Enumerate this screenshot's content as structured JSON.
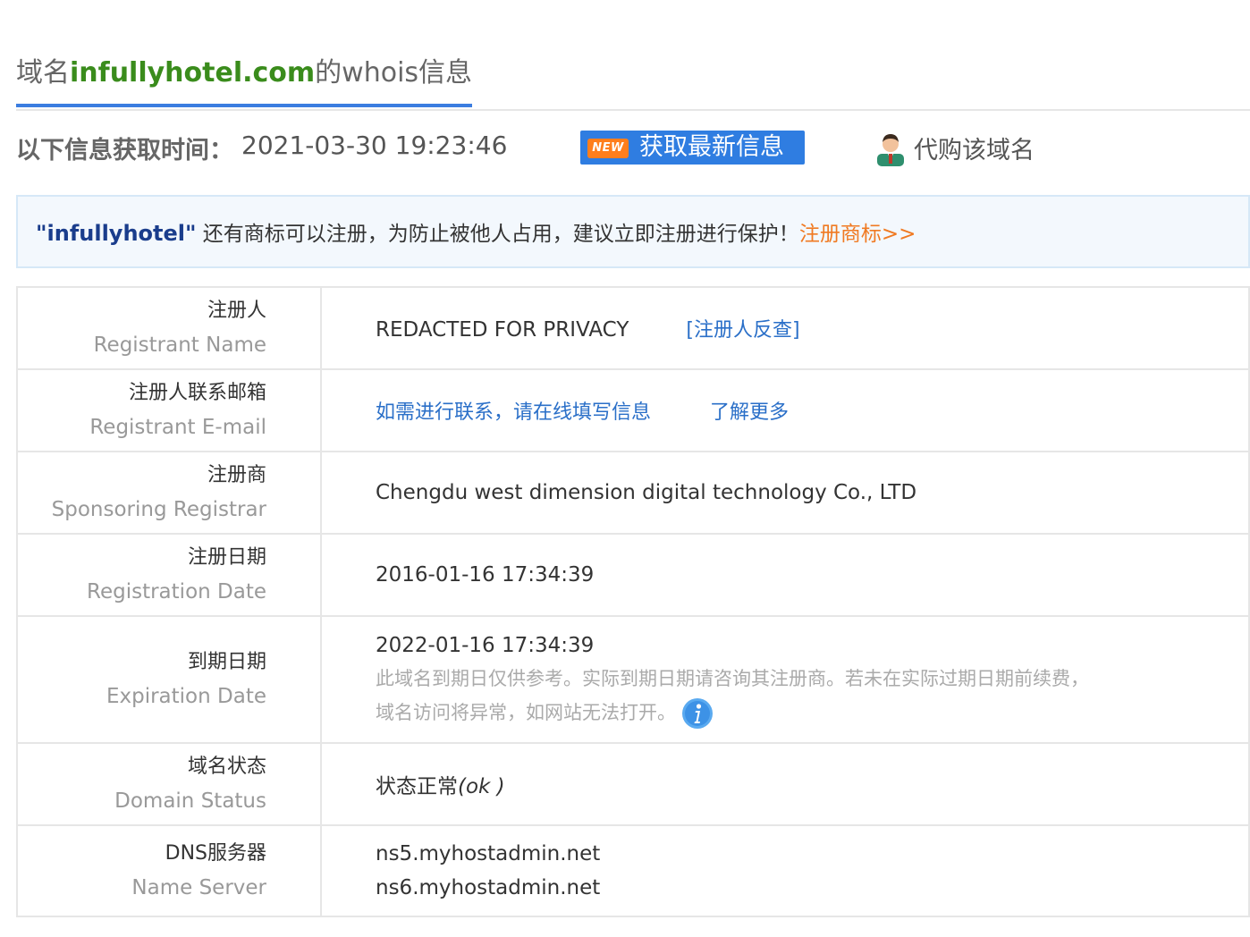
{
  "title": {
    "prefix": "域名",
    "domain": "infullyhotel.com",
    "suffix": "的whois信息"
  },
  "fetch": {
    "label": "以下信息获取时间：",
    "time": "2021-03-30 19:23:46",
    "refresh_badge": "NEW",
    "refresh_label": "获取最新信息",
    "buy_label": "代购该域名"
  },
  "notice": {
    "brand": "\"infullyhotel\"",
    "text": " 还有商标可以注册，为防止被他人占用，建议立即注册进行保护！",
    "link": "注册商标>>"
  },
  "rows": {
    "registrant": {
      "cn": "注册人",
      "en": "Registrant Name",
      "value": "REDACTED FOR PRIVACY",
      "link": "[注册人反查]"
    },
    "email": {
      "cn": "注册人联系邮箱",
      "en": "Registrant E-mail",
      "link1": "如需进行联系，请在线填写信息",
      "link2": "了解更多"
    },
    "registrar": {
      "cn": "注册商",
      "en": "Sponsoring Registrar",
      "value": "Chengdu west dimension digital technology Co., LTD"
    },
    "reg_date": {
      "cn": "注册日期",
      "en": "Registration Date",
      "value": "2016-01-16 17:34:39"
    },
    "exp_date": {
      "cn": "到期日期",
      "en": "Expiration Date",
      "value": "2022-01-16 17:34:39",
      "note1": "此域名到期日仅供参考。实际到期日期请咨询其注册商。若未在实际过期日期前续费，",
      "note2": "域名访问将异常，如网站无法打开。"
    },
    "status": {
      "cn": "域名状态",
      "en": "Domain Status",
      "value_cn": "状态正常",
      "value_en": "(ok )"
    },
    "dns": {
      "cn": "DNS服务器",
      "en": "Name Server",
      "ns1": "ns5.myhostadmin.net",
      "ns2": "ns6.myhostadmin.net"
    }
  },
  "colors": {
    "accent_blue": "#3b7de0",
    "domain_green": "#3a8c1c",
    "link_orange": "#f07a22",
    "badge_orange": "#ff7e1c"
  }
}
